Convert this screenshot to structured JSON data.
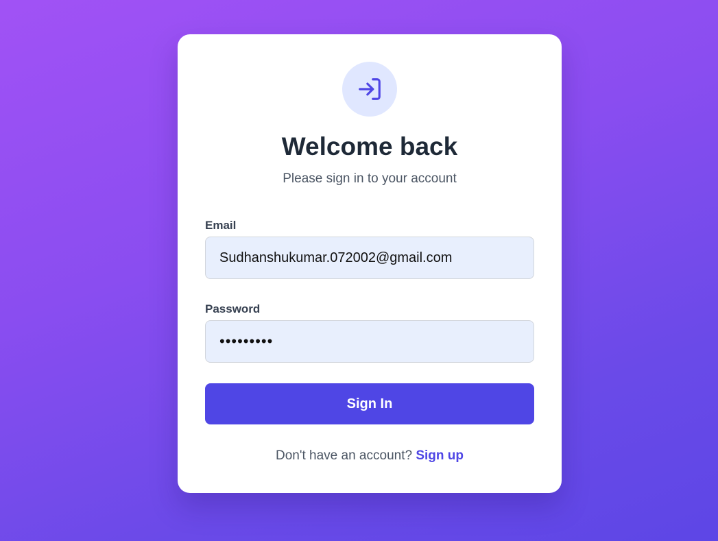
{
  "login": {
    "icon": "login-icon",
    "title": "Welcome back",
    "subtitle": "Please sign in to your account",
    "email_label": "Email",
    "email_value": "Sudhanshukumar.072002@gmail.com",
    "password_label": "Password",
    "password_value": "•••••••••",
    "submit_label": "Sign In",
    "footer_text": "Don't have an account?",
    "signup_link": "Sign up"
  },
  "colors": {
    "accent": "#4f46e5",
    "icon_bg": "#e0e7ff",
    "input_bg": "#e8effd",
    "background_start": "#a152f5",
    "background_end": "#5d46e6"
  }
}
